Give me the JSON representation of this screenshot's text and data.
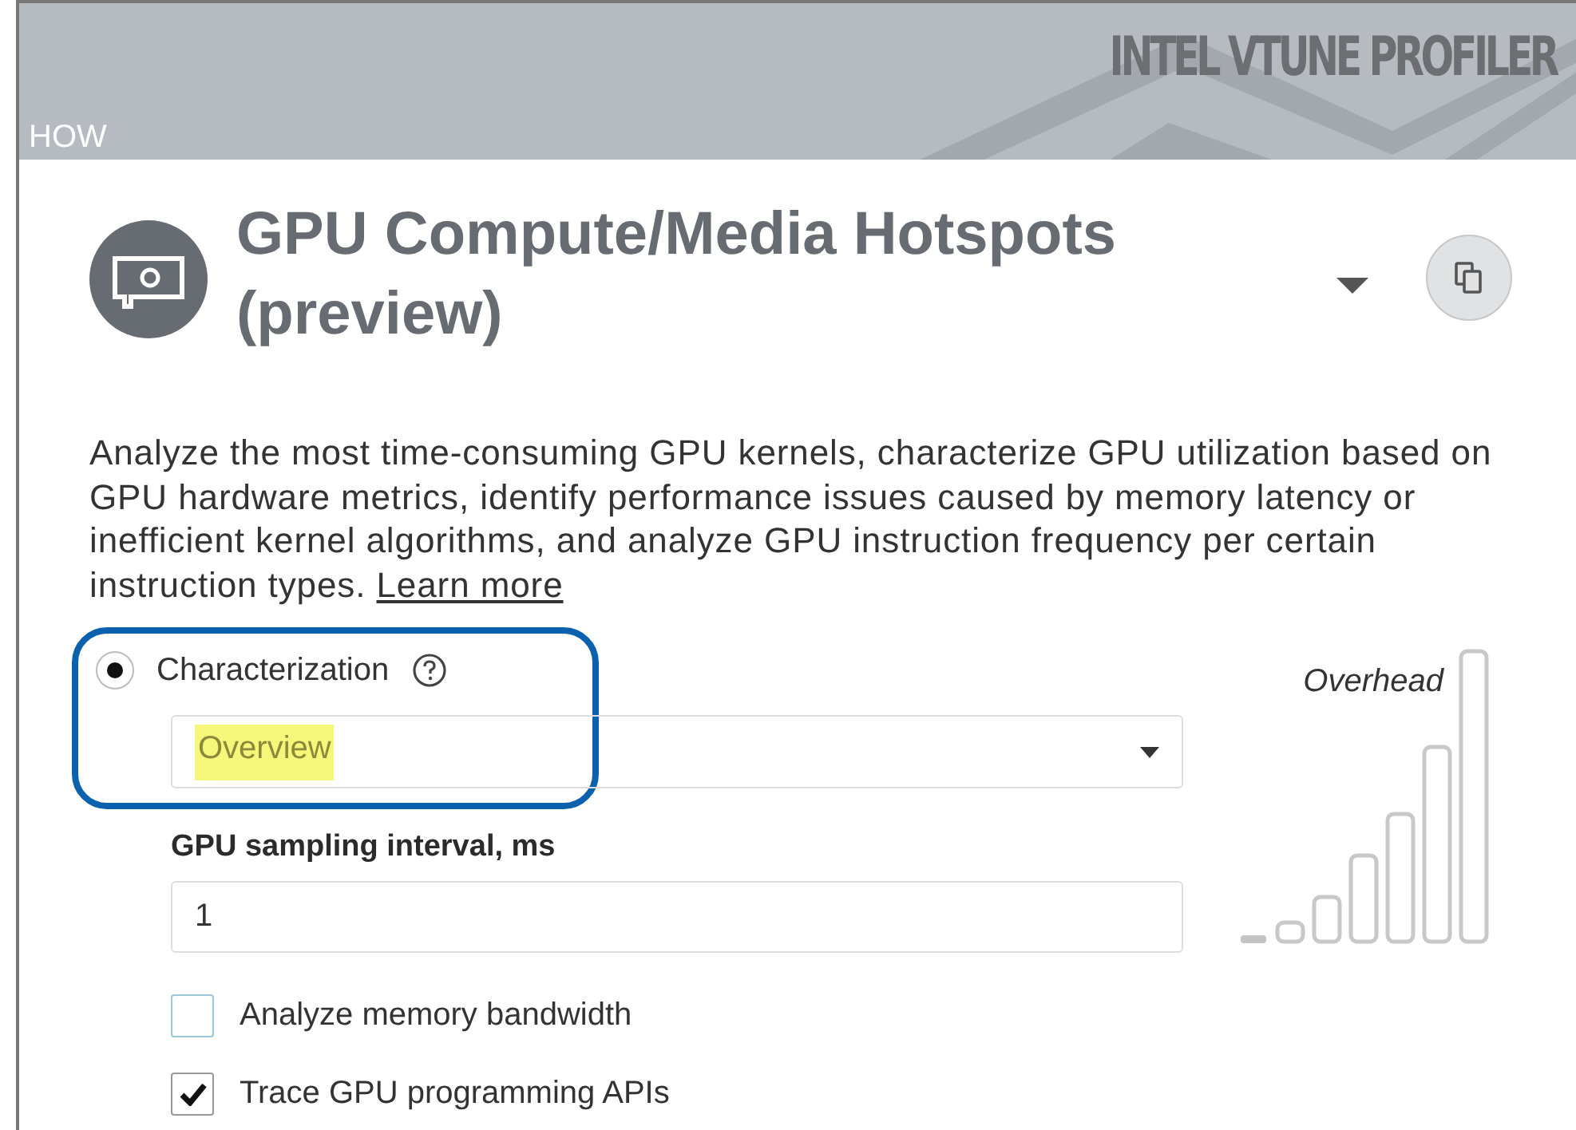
{
  "header": {
    "brand": "INTEL VTUNE PROFILER",
    "section": "HOW"
  },
  "analysis": {
    "title": "GPU Compute/Media Hotspots (preview)",
    "description": "Analyze the most time-consuming GPU kernels, characterize GPU utilization based on GPU hardware metrics, identify performance issues caused by memory latency or inefficient kernel algorithms, and analyze GPU instruction frequency per certain instruction types.",
    "link": "Learn more"
  },
  "mode": {
    "label": "Characterization",
    "selected": true,
    "select_value": "Overview",
    "highlighted": true,
    "annotated": true
  },
  "interval": {
    "label": "GPU sampling interval, ms",
    "value": "1"
  },
  "options": [
    {
      "label": "Analyze memory bandwidth",
      "checked": false
    },
    {
      "label": "Trace GPU programming APIs",
      "checked": true
    }
  ],
  "overhead": {
    "label": "Overhead",
    "level": 0.14
  }
}
